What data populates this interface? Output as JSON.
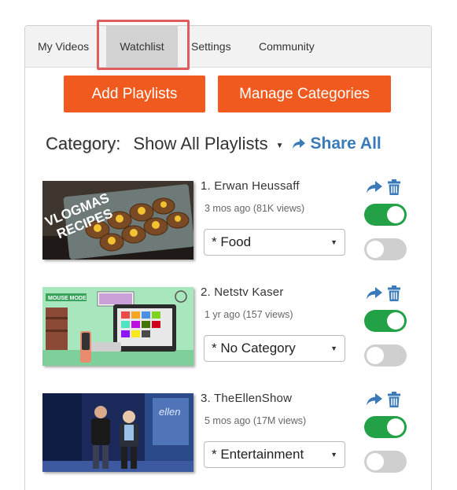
{
  "tabs": [
    {
      "label": "My Videos",
      "active": false
    },
    {
      "label": "Watchlist",
      "active": true
    },
    {
      "label": "Settings",
      "active": false
    },
    {
      "label": "Community",
      "active": false
    }
  ],
  "actions": {
    "add_playlists": "Add Playlists",
    "manage_categories": "Manage Categories"
  },
  "category_filter": {
    "label": "Category:",
    "selected": "Show All Playlists",
    "share_all": "Share All"
  },
  "videos": [
    {
      "title": "1. Erwan Heussaff",
      "meta": "3 mos ago (81K views)",
      "category": "* Food",
      "thumbnail_text": "VLOGMAS RECIPES",
      "toggle_top": true,
      "toggle_bottom": false
    },
    {
      "title": "2. Netstv Kaser",
      "meta": "1 yr ago (157 views)",
      "category": "* No Category",
      "thumbnail_text": "MOUSE MODE",
      "toggle_top": true,
      "toggle_bottom": false
    },
    {
      "title": "3. TheEllenShow",
      "meta": "5 mos ago (17M views)",
      "category": "* Entertainment",
      "thumbnail_text": "ellen",
      "toggle_top": true,
      "toggle_bottom": false
    }
  ],
  "colors": {
    "accent_orange": "#f05a1e",
    "link_blue": "#3a7ab8",
    "toggle_on": "#22a146",
    "toggle_off": "#cfcfcf",
    "highlight_red": "#e05d5d"
  }
}
